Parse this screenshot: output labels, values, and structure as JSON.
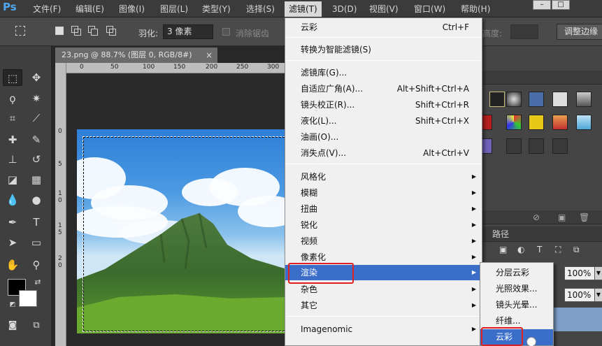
{
  "app": {
    "logo": "Ps"
  },
  "menubar": {
    "items": [
      "文件(F)",
      "编辑(E)",
      "图像(I)",
      "图层(L)",
      "类型(Y)",
      "选择(S)",
      "滤镜(T)",
      "3D(D)",
      "视图(V)",
      "窗口(W)",
      "帮助(H)"
    ],
    "active": "滤镜(T)"
  },
  "window_controls": {
    "minimize": "–",
    "restore": "□"
  },
  "options": {
    "feather_label": "羽化:",
    "feather_value": "3 像素",
    "antialias_label": "消除锯齿",
    "height_label": "高度:",
    "refine_edge": "调整边缘"
  },
  "document": {
    "tab_title": "23.png @ 88.7% (图层 0, RGB/8#)",
    "close": "×",
    "ruler_top": [
      "0",
      "50",
      "100",
      "150",
      "200",
      "250",
      "300"
    ],
    "ruler_left": [
      "0",
      "5",
      "1",
      "0",
      "1",
      "5",
      "2",
      "0"
    ]
  },
  "filter_menu": {
    "last_filter": {
      "label": "云彩",
      "shortcut": "Ctrl+F"
    },
    "convert_smart": {
      "label": "转换为智能滤镜(S)"
    },
    "group2": [
      {
        "label": "滤镜库(G)...",
        "shortcut": ""
      },
      {
        "label": "自适应广角(A)...",
        "shortcut": "Alt+Shift+Ctrl+A"
      },
      {
        "label": "镜头校正(R)...",
        "shortcut": "Shift+Ctrl+R"
      },
      {
        "label": "液化(L)...",
        "shortcut": "Shift+Ctrl+X"
      },
      {
        "label": "油画(O)...",
        "shortcut": ""
      },
      {
        "label": "消失点(V)...",
        "shortcut": "Alt+Ctrl+V"
      }
    ],
    "submenus": [
      "风格化",
      "模糊",
      "扭曲",
      "锐化",
      "视频",
      "像素化",
      "渲染",
      "杂色",
      "其它"
    ],
    "highlighted": "渲染",
    "plugin": "Imagenomic",
    "arrow": "▶"
  },
  "render_submenu": {
    "items": [
      "分层云彩",
      "光照效果...",
      "镜头光晕...",
      "纤维...",
      "云彩"
    ],
    "highlighted": "云彩"
  },
  "right_panel": {
    "path_tab": "路径",
    "opacity_value": "100%",
    "fill_value": "100%",
    "dropdown": "▼"
  },
  "toolbar": {
    "tools": [
      "marquee",
      "move",
      "lasso",
      "magic-wand",
      "crop",
      "eyedropper",
      "healing",
      "brush",
      "stamp",
      "history-brush",
      "eraser",
      "gradient",
      "blur",
      "dodge",
      "pen",
      "type",
      "path-select",
      "shape",
      "hand",
      "zoom"
    ]
  },
  "colors": {
    "menu_highlight": "#3a6ec9",
    "annotation": "#e02020",
    "foreground": "#000000",
    "background": "#ffffff"
  }
}
